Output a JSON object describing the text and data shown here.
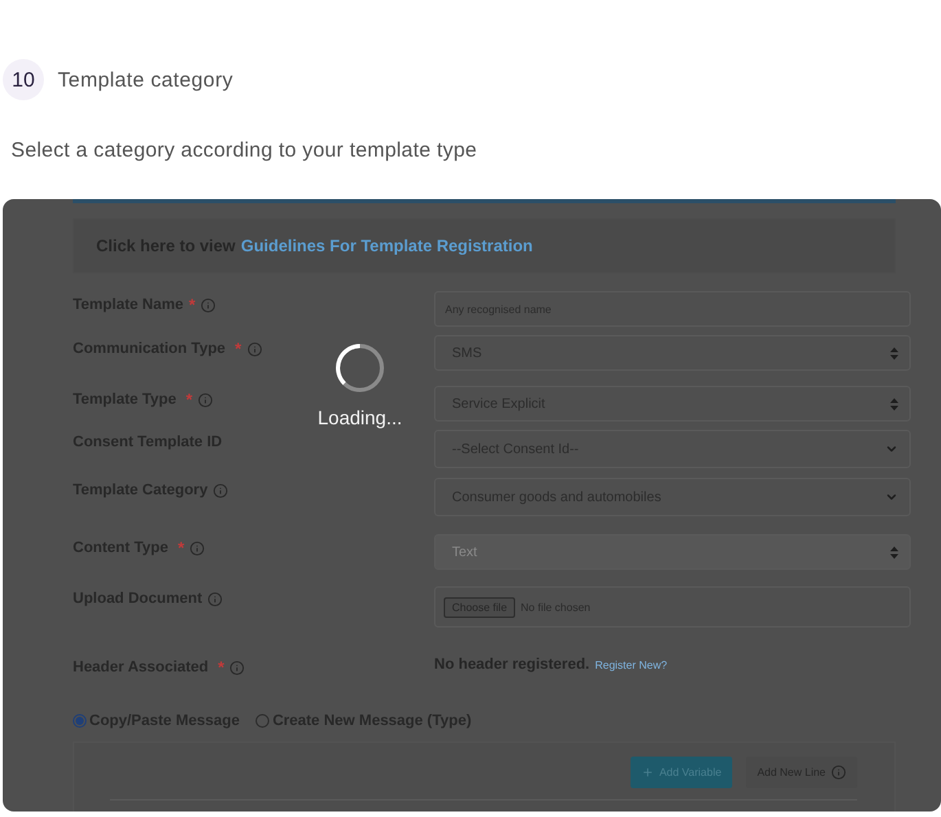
{
  "step": {
    "number": "10",
    "title": "Template category"
  },
  "subtitle": "Select a category according to your template type",
  "form": {
    "guidelines": {
      "prefix": "Click here to view",
      "link": "Guidelines For Template Registration"
    },
    "fields": [
      {
        "kind": "text",
        "label": "Template Name",
        "required_mark": "*",
        "info": true,
        "placeholder": "Any recognised name"
      },
      {
        "kind": "select-updown",
        "label": "Communication Type",
        "required_mark": "*",
        "info": true,
        "value": "SMS"
      },
      {
        "kind": "select-updown",
        "label": "Template Type",
        "required_mark": "*",
        "info": true,
        "value": "Service Explicit"
      },
      {
        "kind": "select-chevron",
        "label": "Consent Template ID",
        "info": false,
        "value": "--Select Consent Id--"
      },
      {
        "kind": "select-chevron",
        "label": "Template Category",
        "info": true,
        "value": "Consumer goods and automobiles"
      },
      {
        "kind": "select-updown",
        "label": "Content Type",
        "required_mark": "*",
        "info": true,
        "value": "Text",
        "disabled": true
      },
      {
        "kind": "file",
        "label": "Upload Document",
        "info": true,
        "button": "Choose file",
        "value": "No file chosen"
      },
      {
        "kind": "note",
        "label": "Header Associated",
        "required_mark": "*",
        "info": true,
        "value": "No header registered.",
        "link": "Register New?"
      }
    ],
    "message_modes": [
      {
        "label": "Copy/Paste Message",
        "selected": true
      },
      {
        "label": "Create New Message (Type)",
        "selected": false
      }
    ],
    "buttons": [
      {
        "kind": "primary",
        "label": "Add Variable"
      },
      {
        "kind": "secondary",
        "label": "Add New Line"
      }
    ]
  },
  "loader": {
    "text": "Loading..."
  }
}
